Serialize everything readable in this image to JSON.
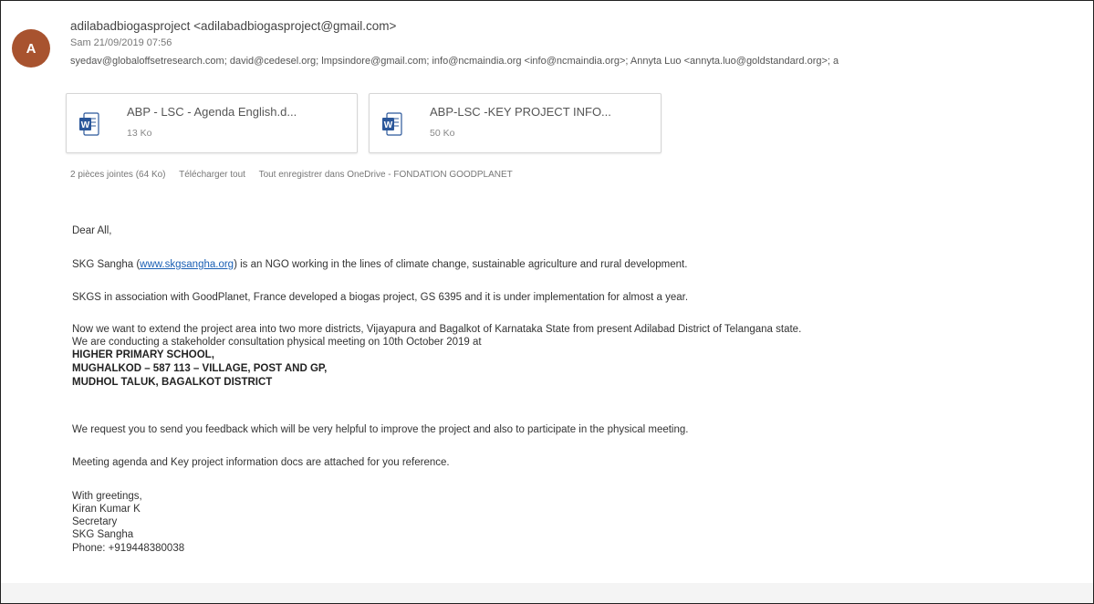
{
  "header": {
    "avatar_letter": "A",
    "sender": "adilabadbiogasproject <adilabadbiogasproject@gmail.com>",
    "date": "Sam 21/09/2019 07:56",
    "recipients": "syedav@globaloffsetresearch.com; david@cedesel.org; lmpsindore@gmail.com; info@ncmaindia.org <info@ncmaindia.org>; Annyta Luo <annyta.luo@goldstandard.org>; a"
  },
  "attachments": {
    "items": [
      {
        "name": "ABP - LSC - Agenda English.d...",
        "size": "13 Ko",
        "icon": "word-doc-icon"
      },
      {
        "name": "ABP-LSC -KEY PROJECT INFO...",
        "size": "50 Ko",
        "icon": "word-doc-icon"
      }
    ],
    "summary_count": "2 pièces jointes (64 Ko)",
    "download_all": "Télécharger tout",
    "save_onedrive": "Tout enregistrer dans OneDrive - FONDATION GOODPLANET"
  },
  "body": {
    "greeting": "Dear All,",
    "p1_before": "SKG Sangha (",
    "p1_link": "www.skgsangha.org",
    "p1_after": ") is an NGO working in the lines of climate change, sustainable agriculture and rural development.",
    "p2": "SKGS in association with GoodPlanet, France developed a biogas project, GS 6395 and it is under implementation for almost a year.",
    "p3_line1": "Now we want to extend the project area into two more districts, Vijayapura and Bagalkot of Karnataka State from present Adilabad District of Telangana state.",
    "p3_line2": "We are conducting a stakeholder consultation physical meeting on 10th October 2019 at",
    "address_1": "HIGHER PRIMARY SCHOOL,",
    "address_2": "MUGHALKOD – 587 113 – VILLAGE, POST AND GP,",
    "address_3": "MUDHOL TALUK, BAGALKOT DISTRICT",
    "p4": "We request you to send you feedback which will be very helpful to improve the project and also to participate in the physical meeting.",
    "p5": "Meeting agenda and Key project information docs are attached for you reference.",
    "sig_1": "With greetings,",
    "sig_2": "Kiran Kumar K",
    "sig_3": "Secretary",
    "sig_4": "SKG Sangha",
    "sig_5": "Phone: +919448380038"
  }
}
